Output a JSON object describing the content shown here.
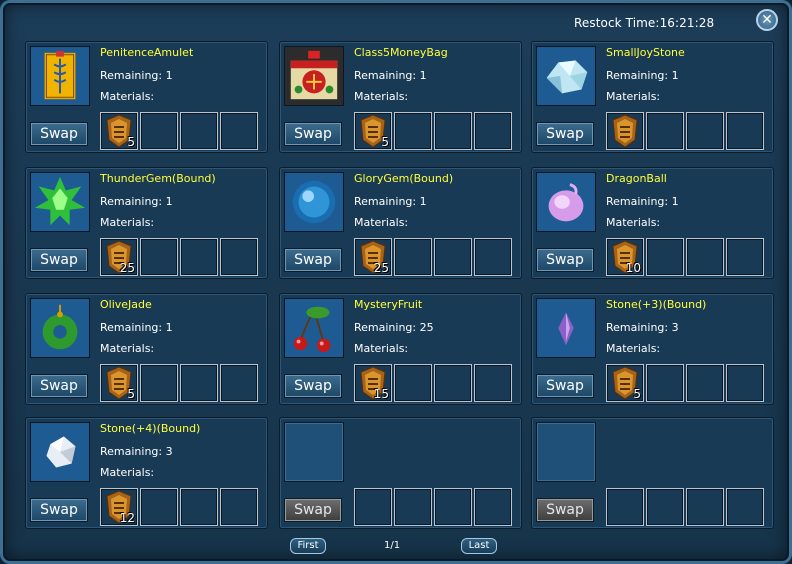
{
  "header": {
    "restock_label": "Restock Time:",
    "restock_time": "16:21:28"
  },
  "labels": {
    "remaining": "Remaining:",
    "materials": "Materials:",
    "swap": "Swap"
  },
  "items": [
    {
      "name": "PenitenceAmulet",
      "remaining": "1",
      "icon": "penitence-amulet-icon",
      "materials": [
        {
          "icon": "token-icon",
          "qty": "5"
        }
      ]
    },
    {
      "name": "Class5MoneyBag",
      "remaining": "1",
      "icon": "money-bag-icon",
      "materials": [
        {
          "icon": "token-icon",
          "qty": "5"
        }
      ]
    },
    {
      "name": "SmallJoyStone",
      "remaining": "1",
      "icon": "joy-stone-icon",
      "materials": [
        {
          "icon": "token-icon",
          "qty": ""
        }
      ]
    },
    {
      "name": "ThunderGem(Bound)",
      "remaining": "1",
      "icon": "thunder-gem-icon",
      "materials": [
        {
          "icon": "token-icon",
          "qty": "25"
        }
      ]
    },
    {
      "name": "GloryGem(Bound)",
      "remaining": "1",
      "icon": "glory-gem-icon",
      "materials": [
        {
          "icon": "token-icon",
          "qty": "25"
        }
      ]
    },
    {
      "name": "DragonBall",
      "remaining": "1",
      "icon": "dragon-ball-icon",
      "materials": [
        {
          "icon": "token-icon",
          "qty": "10"
        }
      ]
    },
    {
      "name": "OliveJade",
      "remaining": "1",
      "icon": "olive-jade-icon",
      "materials": [
        {
          "icon": "token-icon",
          "qty": "5"
        }
      ]
    },
    {
      "name": "MysteryFruit",
      "remaining": "25",
      "icon": "mystery-fruit-icon",
      "materials": [
        {
          "icon": "token-icon",
          "qty": "15"
        }
      ]
    },
    {
      "name": "Stone(+3)(Bound)",
      "remaining": "3",
      "icon": "stone-plus3-icon",
      "materials": [
        {
          "icon": "token-icon",
          "qty": "5"
        }
      ]
    },
    {
      "name": "Stone(+4)(Bound)",
      "remaining": "3",
      "icon": "stone-plus4-icon",
      "materials": [
        {
          "icon": "token-icon",
          "qty": "12"
        }
      ]
    },
    {
      "name": "",
      "remaining": "",
      "icon": "",
      "materials": []
    },
    {
      "name": "",
      "remaining": "",
      "icon": "",
      "materials": []
    }
  ],
  "pager": {
    "first_label": "First",
    "last_label": "Last",
    "current": "1",
    "total": "1"
  },
  "colors": {
    "item_name": "#ffff3c",
    "text": "#ffffff",
    "panel_bg": "#193a55"
  }
}
